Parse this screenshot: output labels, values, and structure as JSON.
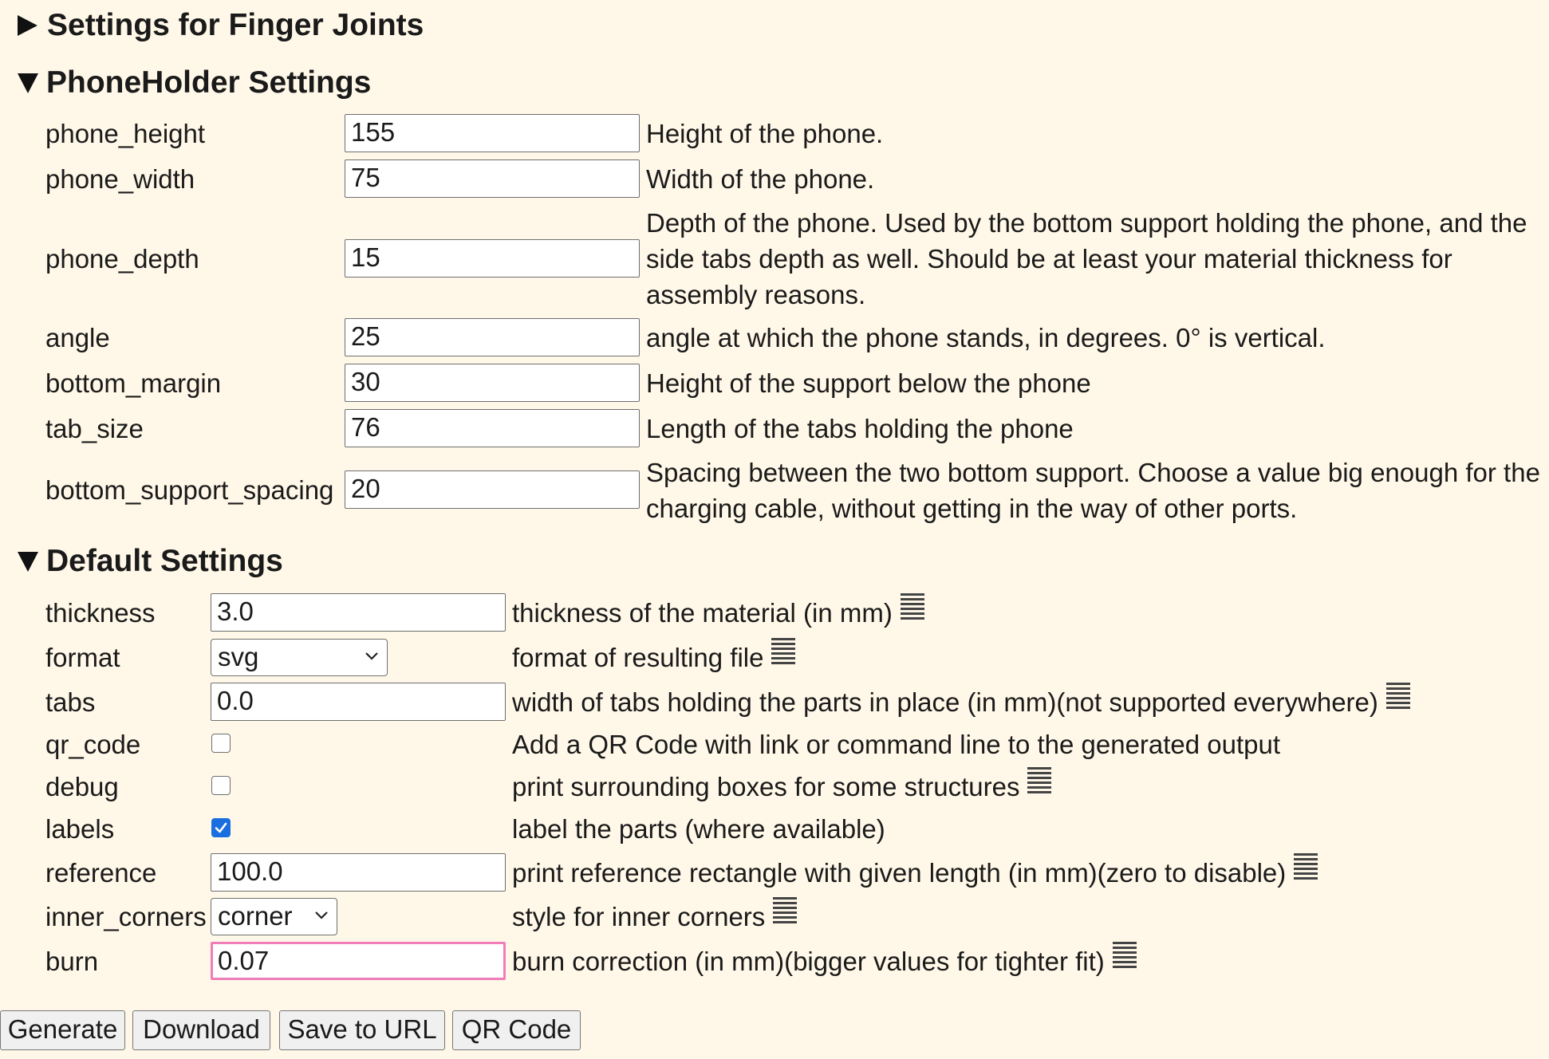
{
  "finger_section": {
    "title": "Settings for Finger Joints",
    "expanded": false
  },
  "phone_section": {
    "title": "PhoneHolder Settings",
    "expanded": true,
    "fields": [
      {
        "label": "phone_height",
        "value": "155",
        "desc": "Height of the phone."
      },
      {
        "label": "phone_width",
        "value": "75",
        "desc": "Width of the phone."
      },
      {
        "label": "phone_depth",
        "value": "15",
        "desc": "Depth of the phone. Used by the bottom support holding the phone, and the side tabs depth as well. Should be at least your material thickness for assembly reasons."
      },
      {
        "label": "angle",
        "value": "25",
        "desc": "angle at which the phone stands, in degrees. 0° is vertical."
      },
      {
        "label": "bottom_margin",
        "value": "30",
        "desc": "Height of the support below the phone"
      },
      {
        "label": "tab_size",
        "value": "76",
        "desc": "Length of the tabs holding the phone"
      },
      {
        "label": "bottom_support_spacing",
        "value": "20",
        "desc": "Spacing between the two bottom support. Choose a value big enough for the charging cable, without getting in the way of other ports."
      }
    ]
  },
  "default_section": {
    "title": "Default Settings",
    "expanded": true,
    "fields": {
      "thickness": {
        "label": "thickness",
        "value": "3.0",
        "desc": "thickness of the material (in mm)",
        "icon": "doc-lines-icon"
      },
      "format": {
        "label": "format",
        "value": "svg",
        "desc": "format of resulting file",
        "icon": "doc-lines-icon"
      },
      "tabs": {
        "label": "tabs",
        "value": "0.0",
        "desc": "width of tabs holding the parts in place (in mm)(not supported everywhere)",
        "icon": "doc-lines-icon"
      },
      "qr_code": {
        "label": "qr_code",
        "checked": false,
        "desc": "Add a QR Code with link or command line to the generated output"
      },
      "debug": {
        "label": "debug",
        "checked": false,
        "desc": "print surrounding boxes for some structures",
        "icon": "doc-lines-icon"
      },
      "labels": {
        "label": "labels",
        "checked": true,
        "desc": "label the parts (where available)"
      },
      "reference": {
        "label": "reference",
        "value": "100.0",
        "desc": "print reference rectangle with given length (in mm)(zero to disable)",
        "icon": "doc-lines-icon"
      },
      "inner_corners": {
        "label": "inner_corners",
        "value": "corner",
        "desc": "style for inner corners",
        "icon": "doc-lines-icon"
      },
      "burn": {
        "label": "burn",
        "value": "0.07",
        "desc": "burn correction (in mm)(bigger values for tighter fit)",
        "icon": "doc-lines-icon"
      }
    }
  },
  "buttons": {
    "generate": "Generate",
    "download": "Download",
    "save_to_url": "Save to URL",
    "qr_code": "QR Code"
  },
  "colors": {
    "background": "#fff8e8",
    "focus_border": "#f07cb8",
    "checkbox_checked": "#1a6fe0"
  }
}
